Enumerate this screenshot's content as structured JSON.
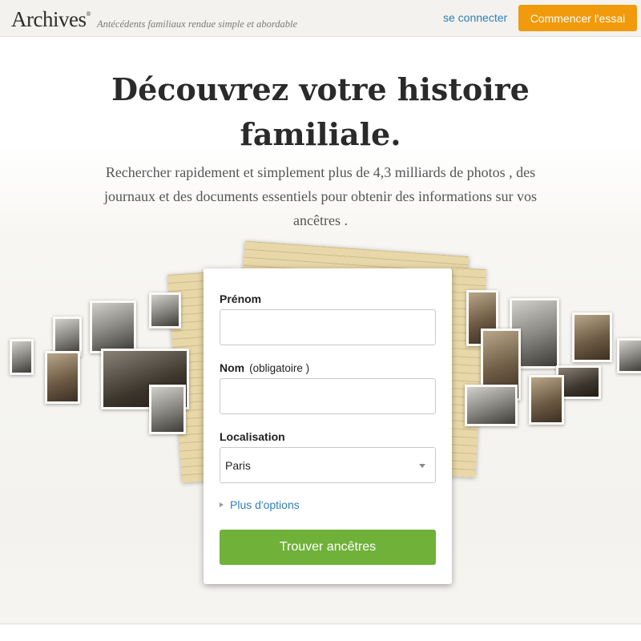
{
  "header": {
    "logo": "Archives",
    "logo_mark": "®",
    "tagline": "Antécédents familiaux rendue simple et abordable",
    "login_label": "se connecter",
    "cta_label": "Commencer l'essai",
    "bg_color": "#f3f2ee",
    "cta_color": "#f09a0c",
    "link_color": "#2f7fb8"
  },
  "hero": {
    "title_line1": "Découvrez votre histoire",
    "title_line2": "familiale.",
    "subtitle_line1": "Rechercher rapidement et simplement plus de 4,3 milliards de photos , des",
    "subtitle_line2": "journaux et des documents essentiels pour obtenir des informations sur vos",
    "subtitle_line3": "ancêtres ."
  },
  "form": {
    "first_name_label": "Prénom",
    "first_name_value": "",
    "last_name_label": "Nom",
    "last_name_hint": "(obligatoire )",
    "last_name_value": "",
    "location_label": "Localisation",
    "location_value": "Paris",
    "more_options": "Plus d'options",
    "submit_label": "Trouver ancêtres",
    "submit_color": "#70b13a"
  }
}
